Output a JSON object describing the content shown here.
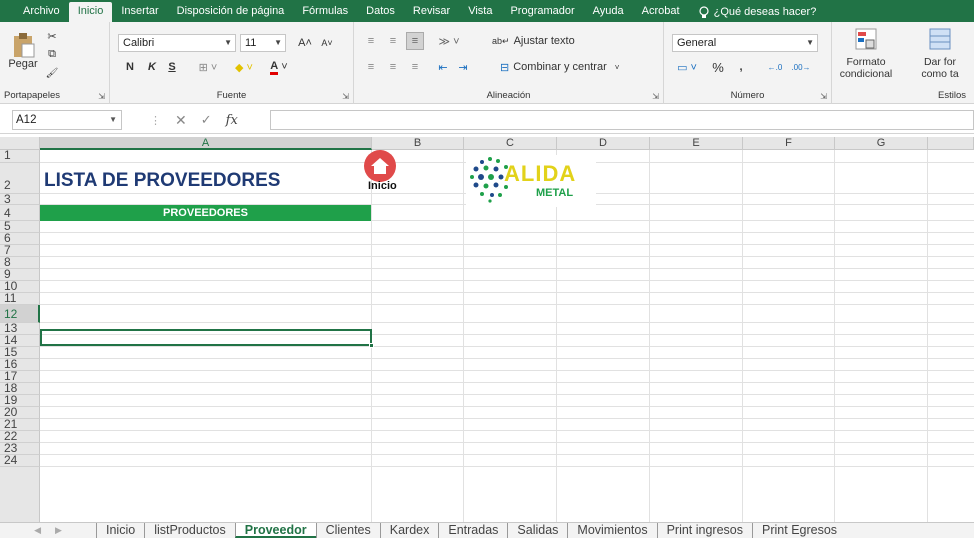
{
  "menu": {
    "items": [
      "Archivo",
      "Inicio",
      "Insertar",
      "Disposición de página",
      "Fórmulas",
      "Datos",
      "Revisar",
      "Vista",
      "Programador",
      "Ayuda",
      "Acrobat"
    ],
    "active_index": 1,
    "tell_me": "¿Qué deseas hacer?"
  },
  "ribbon": {
    "clipboard": {
      "paste": "Pegar",
      "label": "Portapapeles"
    },
    "font": {
      "name": "Calibri",
      "size": "11",
      "bold": "N",
      "italic": "K",
      "underline": "S",
      "label": "Fuente"
    },
    "alignment": {
      "wrap": "Ajustar texto",
      "merge": "Combinar y centrar",
      "label": "Alineación"
    },
    "number": {
      "format": "General",
      "percent": "%",
      "comma": ",",
      "label": "Número"
    },
    "styles": {
      "conditional_1": "Formato",
      "conditional_2": "condicional",
      "table_1": "Dar for",
      "table_2": "como ta",
      "label": "Estilos"
    }
  },
  "formula_bar": {
    "name_box": "A12",
    "fx": "fx",
    "value": ""
  },
  "columns": [
    "A",
    "B",
    "C",
    "D",
    "E",
    "F",
    "G"
  ],
  "selected_column": "A",
  "rows": [
    "1",
    "2",
    "3",
    "4",
    "5",
    "6",
    "7",
    "8",
    "9",
    "10",
    "11",
    "12",
    "13",
    "14",
    "15",
    "16",
    "17",
    "18",
    "19",
    "20",
    "21",
    "22",
    "23",
    "24"
  ],
  "selected_row": "12",
  "cells": {
    "title": "LISTA DE PROVEEDORES",
    "header": "PROVEEDORES",
    "home_label": "Inicio",
    "logo_text": "ALIDA",
    "logo_sub": "METAL"
  },
  "sheets": [
    "Inicio",
    "listProductos",
    "Proveedor",
    "Clientes",
    "Kardex",
    "Entradas",
    "Salidas",
    "Movimientos",
    "Print ingresos",
    "Print Egresos"
  ],
  "active_sheet": "Proveedor",
  "colors": {
    "excel_green": "#217346",
    "header_green": "#1fa04a",
    "title_blue": "#1f3a74",
    "home_red": "#e04a4a",
    "logo_yellow": "#e2d21a"
  }
}
